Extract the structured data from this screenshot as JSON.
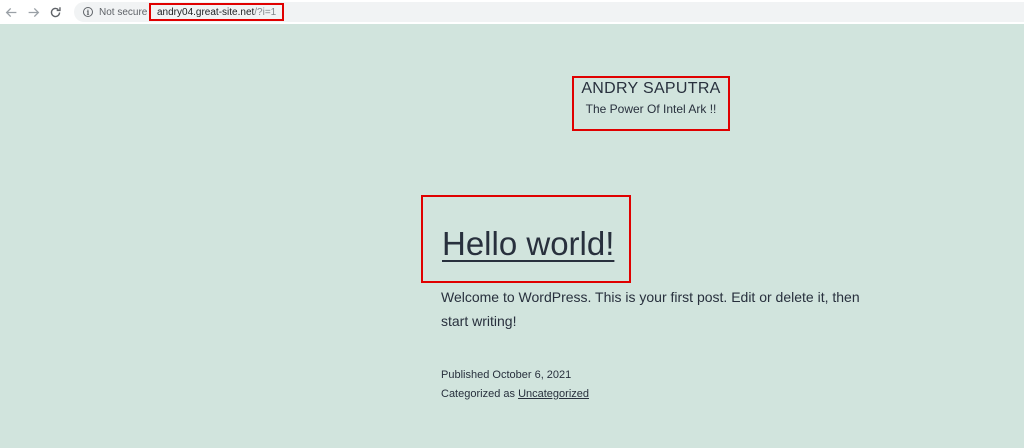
{
  "browser": {
    "security_label": "Not secure",
    "url_host": "andry04.great-site.net",
    "url_path": "/?i=1"
  },
  "site": {
    "title": "ANDRY SAPUTRA",
    "description": "The Power Of Intel Ark !!"
  },
  "post": {
    "title": "Hello world!",
    "body": "Welcome to WordPress. This is your first post. Edit or delete it, then start writing!",
    "published_label": "Published",
    "published_date": "October 6, 2021",
    "category_prefix": "Categorized as",
    "category": "Uncategorized"
  },
  "colors": {
    "page_background": "#d1e4dd",
    "text": "#28303d",
    "highlight_box": "#e00000"
  }
}
